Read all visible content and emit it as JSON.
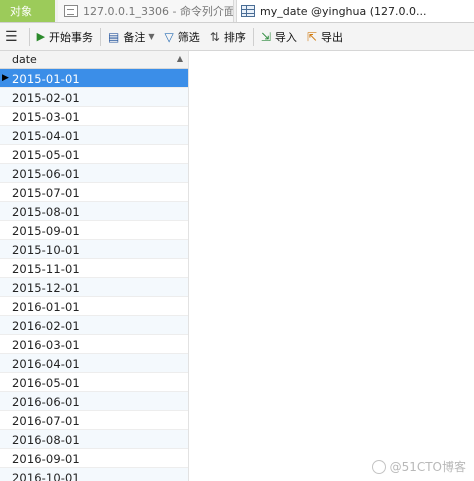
{
  "tabs": [
    {
      "label": "对象",
      "active": false
    },
    {
      "label": "127.0.0.1_3306 - 命令列介面",
      "active": false
    },
    {
      "label": "my_date @yinghua (127.0.0...",
      "active": true
    }
  ],
  "toolbar": {
    "menu_icon": "menu-icon",
    "begin_transaction": "开始事务",
    "memo": "备注",
    "filter": "筛选",
    "sort": "排序",
    "import": "导入",
    "export": "导出"
  },
  "grid": {
    "column": "date",
    "sort_indicator": "▲",
    "current_row_marker": "▶",
    "selected_index": 0,
    "rows": [
      "2015-01-01",
      "2015-02-01",
      "2015-03-01",
      "2015-04-01",
      "2015-05-01",
      "2015-06-01",
      "2015-07-01",
      "2015-08-01",
      "2015-09-01",
      "2015-10-01",
      "2015-11-01",
      "2015-12-01",
      "2016-01-01",
      "2016-02-01",
      "2016-03-01",
      "2016-04-01",
      "2016-05-01",
      "2016-06-01",
      "2016-07-01",
      "2016-08-01",
      "2016-09-01",
      "2016-10-01"
    ]
  },
  "watermark": "@51CTO博客",
  "colors": {
    "objects_tab": "#9ccb5a",
    "selected_row": "#3b8ee8",
    "alt_row": "#f4f9fd"
  }
}
